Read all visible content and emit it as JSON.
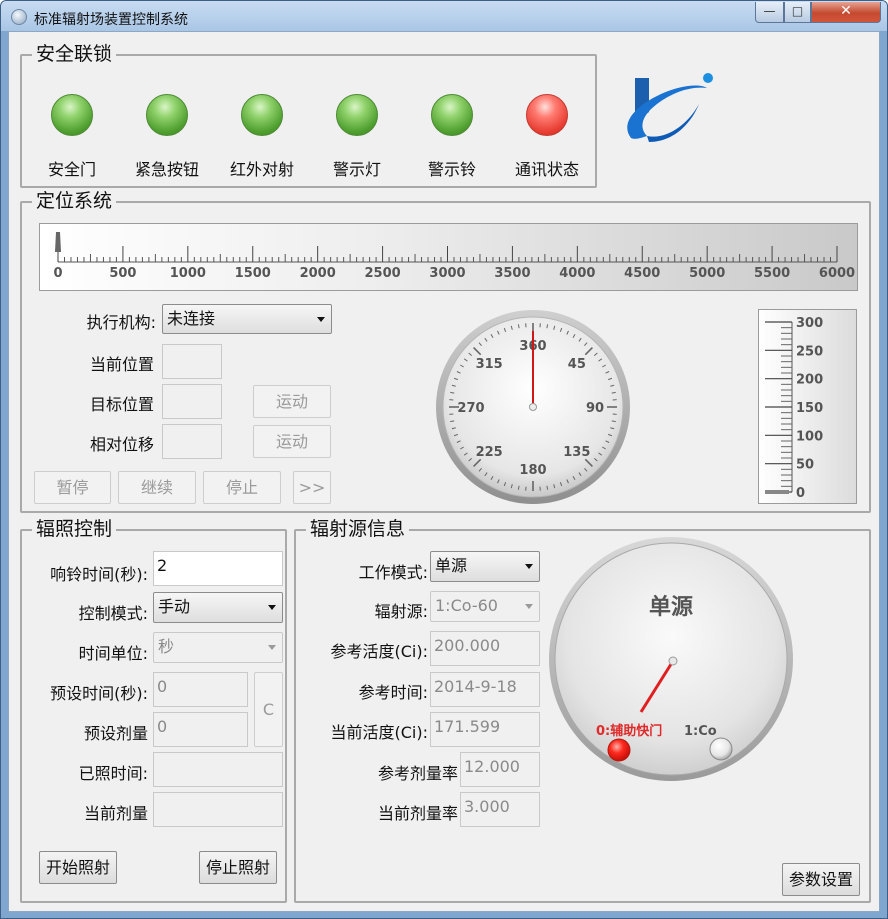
{
  "window": {
    "title": "标准辐射场装置控制系统",
    "min_glyph": "—",
    "max_glyph": "□",
    "close_glyph": "✕"
  },
  "safety": {
    "title": "安全联锁",
    "lamps": [
      {
        "label": "安全门",
        "status": "green"
      },
      {
        "label": "紧急按钮",
        "status": "green"
      },
      {
        "label": "红外对射",
        "status": "green"
      },
      {
        "label": "警示灯",
        "status": "green"
      },
      {
        "label": "警示铃",
        "status": "green"
      },
      {
        "label": "通讯状态",
        "status": "red"
      }
    ]
  },
  "positioning": {
    "title": "定位系统",
    "ruler_ticks": [
      "0",
      "500",
      "1000",
      "1500",
      "2000",
      "2500",
      "3000",
      "3500",
      "4000",
      "4500",
      "5000",
      "5500",
      "6000"
    ],
    "actuator_label": "执行机构:",
    "actuator_value": "未连接",
    "current_pos_label": "当前位置",
    "current_pos_value": "",
    "target_pos_label": "目标位置",
    "target_pos_value": "",
    "relative_label": "相对位移",
    "relative_value": "",
    "move_label": "运动",
    "pause_label": "暂停",
    "resume_label": "继续",
    "stop_label": "停止",
    "more_label": ">>",
    "dial_labels": [
      "360",
      "45",
      "90",
      "135",
      "180",
      "225",
      "270",
      "315"
    ],
    "vertical_scale": [
      "300",
      "250",
      "200",
      "150",
      "100",
      "50",
      "0"
    ]
  },
  "irradiation": {
    "title": "辐照控制",
    "bell_time_label": "响铃时间(秒):",
    "bell_time_value": "2",
    "control_mode_label": "控制模式:",
    "control_mode_value": "手动",
    "time_unit_label": "时间单位:",
    "time_unit_value": "秒",
    "preset_time_label": "预设时间(秒):",
    "preset_time_value": "0",
    "preset_dose_label": "预设剂量",
    "preset_dose_value": "0",
    "clear_label": "C",
    "elapsed_label": "已照时间:",
    "elapsed_value": "",
    "current_dose_label": "当前剂量",
    "current_dose_value": "",
    "start_label": "开始照射",
    "stop_label": "停止照射"
  },
  "source": {
    "title": "辐射源信息",
    "work_mode_label": "工作模式:",
    "work_mode_value": "单源",
    "source_label": "辐射源:",
    "source_value": "1:Co-60",
    "ref_activity_label": "参考活度(Ci):",
    "ref_activity_value": "200.000",
    "ref_time_label": "参考时间:",
    "ref_time_value": "2014-9-18",
    "cur_activity_label": "当前活度(Ci):",
    "cur_activity_value": "171.599",
    "ref_doserate_label": "参考剂量率",
    "ref_doserate_value": "12.000",
    "cur_doserate_label": "当前剂量率",
    "cur_doserate_value": "3.000",
    "knob_title": "单源",
    "knob_left_label": "0:辅助快门",
    "knob_right_label": "1:Co",
    "settings_label": "参数设置"
  }
}
